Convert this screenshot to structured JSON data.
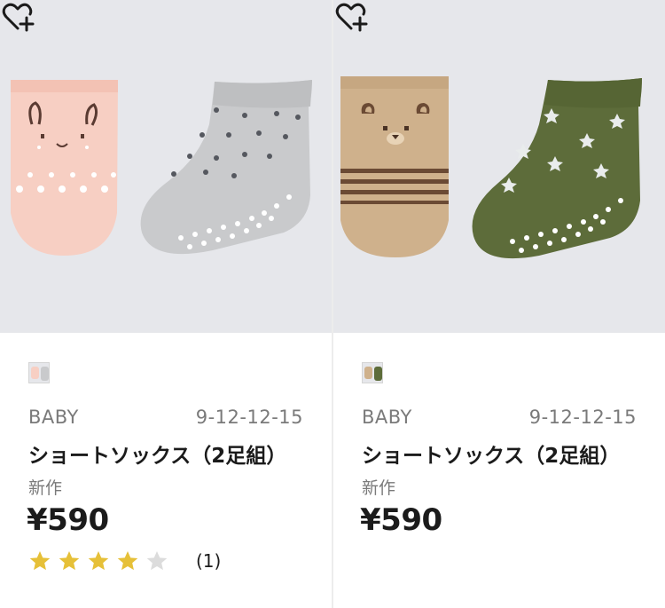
{
  "colors": {
    "image_bg": "#e6e7eb",
    "star_filled": "#e6c038",
    "star_empty": "#dcdcdc",
    "text_primary": "#1b1b1b",
    "text_secondary": "#7a7a7a"
  },
  "products": [
    {
      "image_icons": [
        "bunny-sock-icon",
        "heart-pattern-sock-icon"
      ],
      "favorite_icon": "heart-plus-icon",
      "swatch_icon": "color-swatch-pink-gray",
      "gender": "BABY",
      "sizes": "9-12-12-15",
      "name": "ショートソックス（2足組）",
      "flag": "新作",
      "price": "¥590",
      "rating": 4,
      "rating_max": 5,
      "review_count": "(1)"
    },
    {
      "image_icons": [
        "bear-sock-icon",
        "star-pattern-sock-icon"
      ],
      "favorite_icon": "heart-plus-icon",
      "swatch_icon": "color-swatch-olive-beige",
      "gender": "BABY",
      "sizes": "9-12-12-15",
      "name": "ショートソックス（2足組）",
      "flag": "新作",
      "price": "¥590"
    }
  ]
}
